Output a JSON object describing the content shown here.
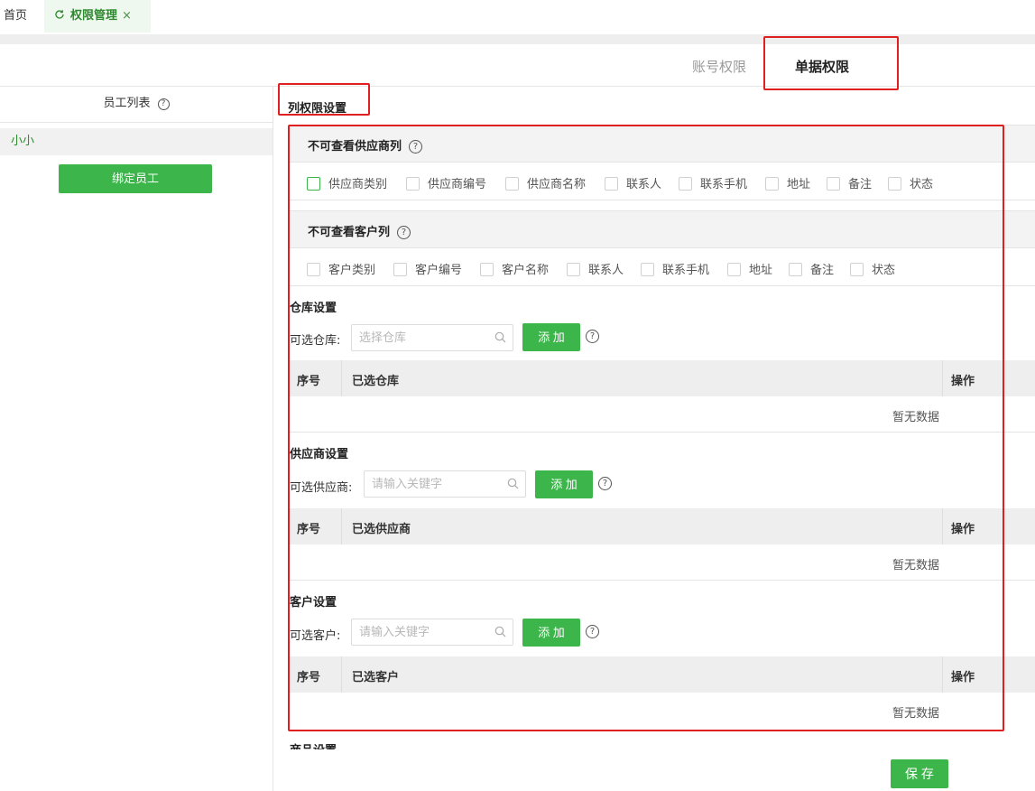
{
  "tabs": {
    "home": "首页",
    "active": "权限管理"
  },
  "subtabs": {
    "account": "账号权限",
    "document": "单据权限"
  },
  "left": {
    "header": "员工列表",
    "employee": "小小",
    "bind_button": "绑定员工"
  },
  "column_settings": {
    "title": "列权限设置",
    "supplier_cols": {
      "title": "不可查看供应商列",
      "options": [
        "供应商类别",
        "供应商编号",
        "供应商名称",
        "联系人",
        "联系手机",
        "地址",
        "备注",
        "状态"
      ]
    },
    "customer_cols": {
      "title": "不可查看客户列",
      "options": [
        "客户类别",
        "客户编号",
        "客户名称",
        "联系人",
        "联系手机",
        "地址",
        "备注",
        "状态"
      ]
    }
  },
  "warehouse": {
    "title": "仓库设置",
    "label": "可选仓库:",
    "placeholder": "选择仓库",
    "add": "添 加",
    "col_index": "序号",
    "col_name": "已选仓库",
    "col_action": "操作",
    "empty": "暂无数据"
  },
  "supplier": {
    "title": "供应商设置",
    "label": "可选供应商:",
    "placeholder": "请输入关键字",
    "add": "添 加",
    "col_index": "序号",
    "col_name": "已选供应商",
    "col_action": "操作",
    "empty": "暂无数据"
  },
  "customer": {
    "title": "客户设置",
    "label": "可选客户:",
    "placeholder": "请输入关键字",
    "add": "添 加",
    "col_index": "序号",
    "col_name": "已选客户",
    "col_action": "操作",
    "empty": "暂无数据"
  },
  "goods": {
    "title": "商品设置"
  },
  "save": "保 存",
  "colors": {
    "accent": "#3cb54a",
    "highlight": "#e02020"
  }
}
